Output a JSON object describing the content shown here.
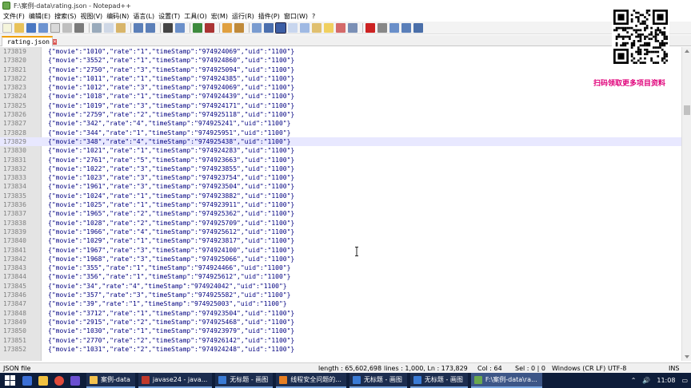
{
  "window": {
    "title": "F:\\案例-data\\rating.json - Notepad++"
  },
  "menu": [
    "文件(F)",
    "编辑(E)",
    "搜索(S)",
    "视图(V)",
    "编码(N)",
    "语言(L)",
    "设置(T)",
    "工具(O)",
    "宏(M)",
    "运行(R)",
    "插件(P)",
    "窗口(W)",
    "?"
  ],
  "tabs": [
    {
      "label": "rating.json",
      "close": "✕"
    }
  ],
  "editor": {
    "current_line": 173829,
    "lines": [
      {
        "n": "173819",
        "movie": "1010",
        "rate": "1",
        "ts": "974924069",
        "uid": "1100"
      },
      {
        "n": "173820",
        "movie": "3552",
        "rate": "1",
        "ts": "974924860",
        "uid": "1100"
      },
      {
        "n": "173821",
        "movie": "2750",
        "rate": "3",
        "ts": "974925094",
        "uid": "1100"
      },
      {
        "n": "173822",
        "movie": "1011",
        "rate": "1",
        "ts": "974924385",
        "uid": "1100"
      },
      {
        "n": "173823",
        "movie": "1012",
        "rate": "3",
        "ts": "974924069",
        "uid": "1100"
      },
      {
        "n": "173824",
        "movie": "1018",
        "rate": "1",
        "ts": "974924439",
        "uid": "1100"
      },
      {
        "n": "173825",
        "movie": "1019",
        "rate": "3",
        "ts": "974924171",
        "uid": "1100"
      },
      {
        "n": "173826",
        "movie": "2759",
        "rate": "2",
        "ts": "974925118",
        "uid": "1100"
      },
      {
        "n": "173827",
        "movie": "342",
        "rate": "4",
        "ts": "974925241",
        "uid": "1100"
      },
      {
        "n": "173828",
        "movie": "344",
        "rate": "1",
        "ts": "974925951",
        "uid": "1100"
      },
      {
        "n": "173829",
        "movie": "348",
        "rate": "4",
        "ts": "974925438",
        "uid": "1100"
      },
      {
        "n": "173830",
        "movie": "1021",
        "rate": "1",
        "ts": "974924283",
        "uid": "1100"
      },
      {
        "n": "173831",
        "movie": "2761",
        "rate": "5",
        "ts": "974923663",
        "uid": "1100"
      },
      {
        "n": "173832",
        "movie": "1022",
        "rate": "3",
        "ts": "974923855",
        "uid": "1100"
      },
      {
        "n": "173833",
        "movie": "1023",
        "rate": "3",
        "ts": "974923754",
        "uid": "1100"
      },
      {
        "n": "173834",
        "movie": "1961",
        "rate": "3",
        "ts": "974923504",
        "uid": "1100"
      },
      {
        "n": "173835",
        "movie": "1024",
        "rate": "1",
        "ts": "974923882",
        "uid": "1100"
      },
      {
        "n": "173836",
        "movie": "1025",
        "rate": "1",
        "ts": "974923911",
        "uid": "1100"
      },
      {
        "n": "173837",
        "movie": "1965",
        "rate": "2",
        "ts": "974925362",
        "uid": "1100"
      },
      {
        "n": "173838",
        "movie": "1028",
        "rate": "2",
        "ts": "974925709",
        "uid": "1100"
      },
      {
        "n": "173839",
        "movie": "1966",
        "rate": "4",
        "ts": "974925612",
        "uid": "1100"
      },
      {
        "n": "173840",
        "movie": "1029",
        "rate": "1",
        "ts": "974923817",
        "uid": "1100"
      },
      {
        "n": "173841",
        "movie": "1967",
        "rate": "3",
        "ts": "974924100",
        "uid": "1100"
      },
      {
        "n": "173842",
        "movie": "1968",
        "rate": "3",
        "ts": "974925066",
        "uid": "1100"
      },
      {
        "n": "173843",
        "movie": "355",
        "rate": "1",
        "ts": "974924466",
        "uid": "1100"
      },
      {
        "n": "173844",
        "movie": "356",
        "rate": "1",
        "ts": "974925612",
        "uid": "1100"
      },
      {
        "n": "173845",
        "movie": "34",
        "rate": "4",
        "ts": "974924042",
        "uid": "1100"
      },
      {
        "n": "173846",
        "movie": "357",
        "rate": "3",
        "ts": "974925582",
        "uid": "1100"
      },
      {
        "n": "173847",
        "movie": "39",
        "rate": "1",
        "ts": "974925003",
        "uid": "1100"
      },
      {
        "n": "173848",
        "movie": "3712",
        "rate": "1",
        "ts": "974923504",
        "uid": "1100"
      },
      {
        "n": "173849",
        "movie": "2915",
        "rate": "2",
        "ts": "974925468",
        "uid": "1100"
      },
      {
        "n": "173850",
        "movie": "1030",
        "rate": "1",
        "ts": "974923979",
        "uid": "1100"
      },
      {
        "n": "173851",
        "movie": "2770",
        "rate": "2",
        "ts": "974926142",
        "uid": "1100"
      },
      {
        "n": "173852",
        "movie": "1031",
        "rate": "2",
        "ts": "974924248",
        "uid": "1100"
      }
    ]
  },
  "overlay": {
    "qr_caption": "扫码领取更多项目资料"
  },
  "status": {
    "language": "JSON file",
    "length": "length : 65,602,698",
    "lines": "lines : 1,000, Ln : 173,829",
    "col": "Col : 64",
    "sel": "Sel : 0 | 0",
    "eol": "Windows (CR LF)",
    "encoding": "UTF-8",
    "mode": "INS"
  },
  "taskbar": {
    "items": [
      {
        "label": "案例-data",
        "color": "#f2c14e",
        "active": false
      },
      {
        "label": "javase24 - java...",
        "color": "#c0392b",
        "active": false
      },
      {
        "label": "无标题 - 画图",
        "color": "#3a7bd5",
        "active": false
      },
      {
        "label": "线程安全问题的...",
        "color": "#e67e22",
        "active": false
      },
      {
        "label": "无标题 - 画图",
        "color": "#3a7bd5",
        "active": false
      },
      {
        "label": "无标题 - 画图",
        "color": "#3a7bd5",
        "active": false
      },
      {
        "label": "F:\\案例-data\\ra...",
        "color": "#6aa84f",
        "active": true
      }
    ],
    "time": "11:08"
  }
}
